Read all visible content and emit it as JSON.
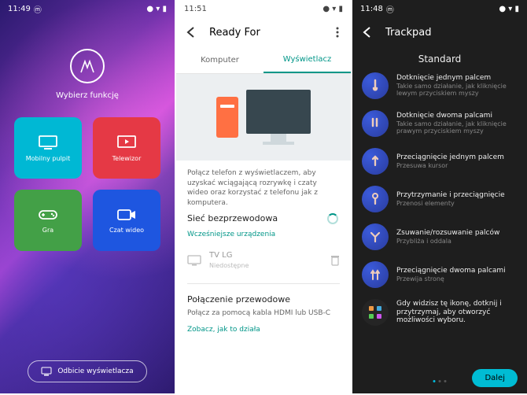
{
  "s1": {
    "time": "11:49",
    "title": "Wybierz funkcję",
    "tiles": [
      {
        "label": "Mobilny pulpit"
      },
      {
        "label": "Telewizor"
      },
      {
        "label": "Gra"
      },
      {
        "label": "Czat wideo"
      }
    ],
    "mirror": "Odbicie wyświetlacza"
  },
  "s2": {
    "time": "11:51",
    "app": "Ready For",
    "tabs": {
      "a": "Komputer",
      "b": "Wyświetlacz"
    },
    "desc": "Połącz telefon z wyświetlaczem, aby uzyskać wciągającą rozrywkę i czaty wideo oraz korzystać z telefonu jak z komputera.",
    "wireless": "Sieć bezprzewodowa",
    "prev": "Wcześniejsze urządzenia",
    "dev": {
      "name": "TV LG",
      "sub": "Niedostępne"
    },
    "wired": "Połączenie przewodowe",
    "wired_sub": "Połącz za pomocą kabla HDMI lub USB-C",
    "link": "Zobacz, jak to działa"
  },
  "s3": {
    "time": "11:48",
    "app": "Trackpad",
    "mode": "Standard",
    "g": [
      {
        "t": "Dotknięcie jednym palcem",
        "s": "Takie samo działanie, jak kliknięcie lewym przyciskiem myszy"
      },
      {
        "t": "Dotknięcie dwoma palcami",
        "s": "Takie samo działanie, jak kliknięcie prawym przyciskiem myszy"
      },
      {
        "t": "Przeciągnięcie jednym palcem",
        "s": "Przesuwa kursor"
      },
      {
        "t": "Przytrzymanie i przeciągnięcie",
        "s": "Przenosi elementy"
      },
      {
        "t": "Zsuwanie/rozsuwanie palców",
        "s": "Przybliża i oddala"
      },
      {
        "t": "Przeciągnięcie dwoma palcami",
        "s": "Przewija stronę"
      },
      {
        "t": "Gdy widzisz tę ikonę, dotknij i przytrzymaj, aby otworzyć możliwości wyboru.",
        "s": ""
      }
    ],
    "next": "Dalej"
  }
}
